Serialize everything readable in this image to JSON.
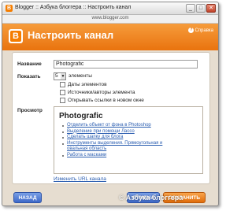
{
  "window": {
    "title": "Blogger :: Азбука блоггера :: Настроить канал",
    "address": "www.blogger.com",
    "buttons": {
      "minimize": "_",
      "maximize": "□",
      "close": "✕"
    }
  },
  "header": {
    "logo_letter": "B",
    "title": "Настроить канал",
    "help_label": "Справка",
    "help_icon": "?"
  },
  "form": {
    "name_label": "Название",
    "name_value": "Photografic",
    "show_label": "Показать",
    "show_value": "5",
    "show_suffix": "элементы",
    "checkboxes": [
      {
        "label": "Даты элементов",
        "checked": false
      },
      {
        "label": "Источники/авторы элемента",
        "checked": false
      },
      {
        "label": "Открывать ссылки в новом окне",
        "checked": false
      }
    ],
    "preview_label": "Просмотр",
    "edit_url_link": "Изменить URL канала"
  },
  "preview": {
    "title": "Photografic",
    "items": [
      "Отделить объект от фона в Photoshop",
      "Выделение при помощи Лассо",
      "Сделать шапку для блога",
      "Инструменты выделения. Прямоугольная и",
      "овальная область",
      "Работа с масками"
    ]
  },
  "footer": {
    "back": "НАЗАД",
    "cancel": "ОТМЕНА",
    "save": "СОХРАНИТЬ"
  },
  "watermark": {
    "symbol": "©",
    "text": "Азбука блоггера"
  },
  "colors": {
    "accent": "#e9730e",
    "link": "#2a5db0",
    "blue_button": "#3d68c8",
    "orange_button": "#e06c0a"
  }
}
